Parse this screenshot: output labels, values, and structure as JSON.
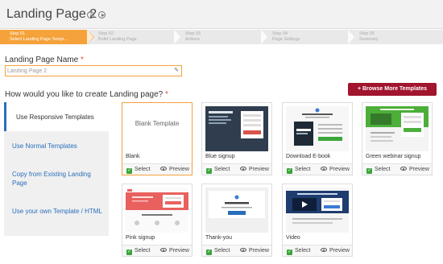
{
  "header": {
    "title": "Landing Page 2"
  },
  "steps": [
    {
      "num": "Step 01",
      "label": "Select Landing Page Templ..."
    },
    {
      "num": "Step 02",
      "label": "Build Landing Page"
    },
    {
      "num": "Step 03",
      "label": "Actions"
    },
    {
      "num": "Step 04",
      "label": "Page Settings"
    },
    {
      "num": "Step 05",
      "label": "Summary"
    }
  ],
  "form": {
    "name_label": "Landing Page Name",
    "required_mark": "*",
    "name_value": "Landing Page 2",
    "question": "How would you like to create Landing page?",
    "question_required": "*"
  },
  "browse_button": "+ Browse More Templates",
  "sidebar": [
    {
      "label": "Use Responsive Templates"
    },
    {
      "label": "Use Normal Templates"
    },
    {
      "label": "Copy from Existing Landing Page"
    },
    {
      "label": "Use your own Template / HTML"
    }
  ],
  "templates": [
    {
      "name": "Blank",
      "thumb_text": "Blank Template"
    },
    {
      "name": "Blue signup"
    },
    {
      "name": "Download E-book"
    },
    {
      "name": "Green webinar signup"
    },
    {
      "name": "Pink signup"
    },
    {
      "name": "Thank-you"
    },
    {
      "name": "Video"
    }
  ],
  "card_actions": {
    "select": "Select",
    "preview": "Preview"
  },
  "colors": {
    "accent": "#f5a23b",
    "brand_button": "#a1152e",
    "link": "#2a6ebb"
  }
}
